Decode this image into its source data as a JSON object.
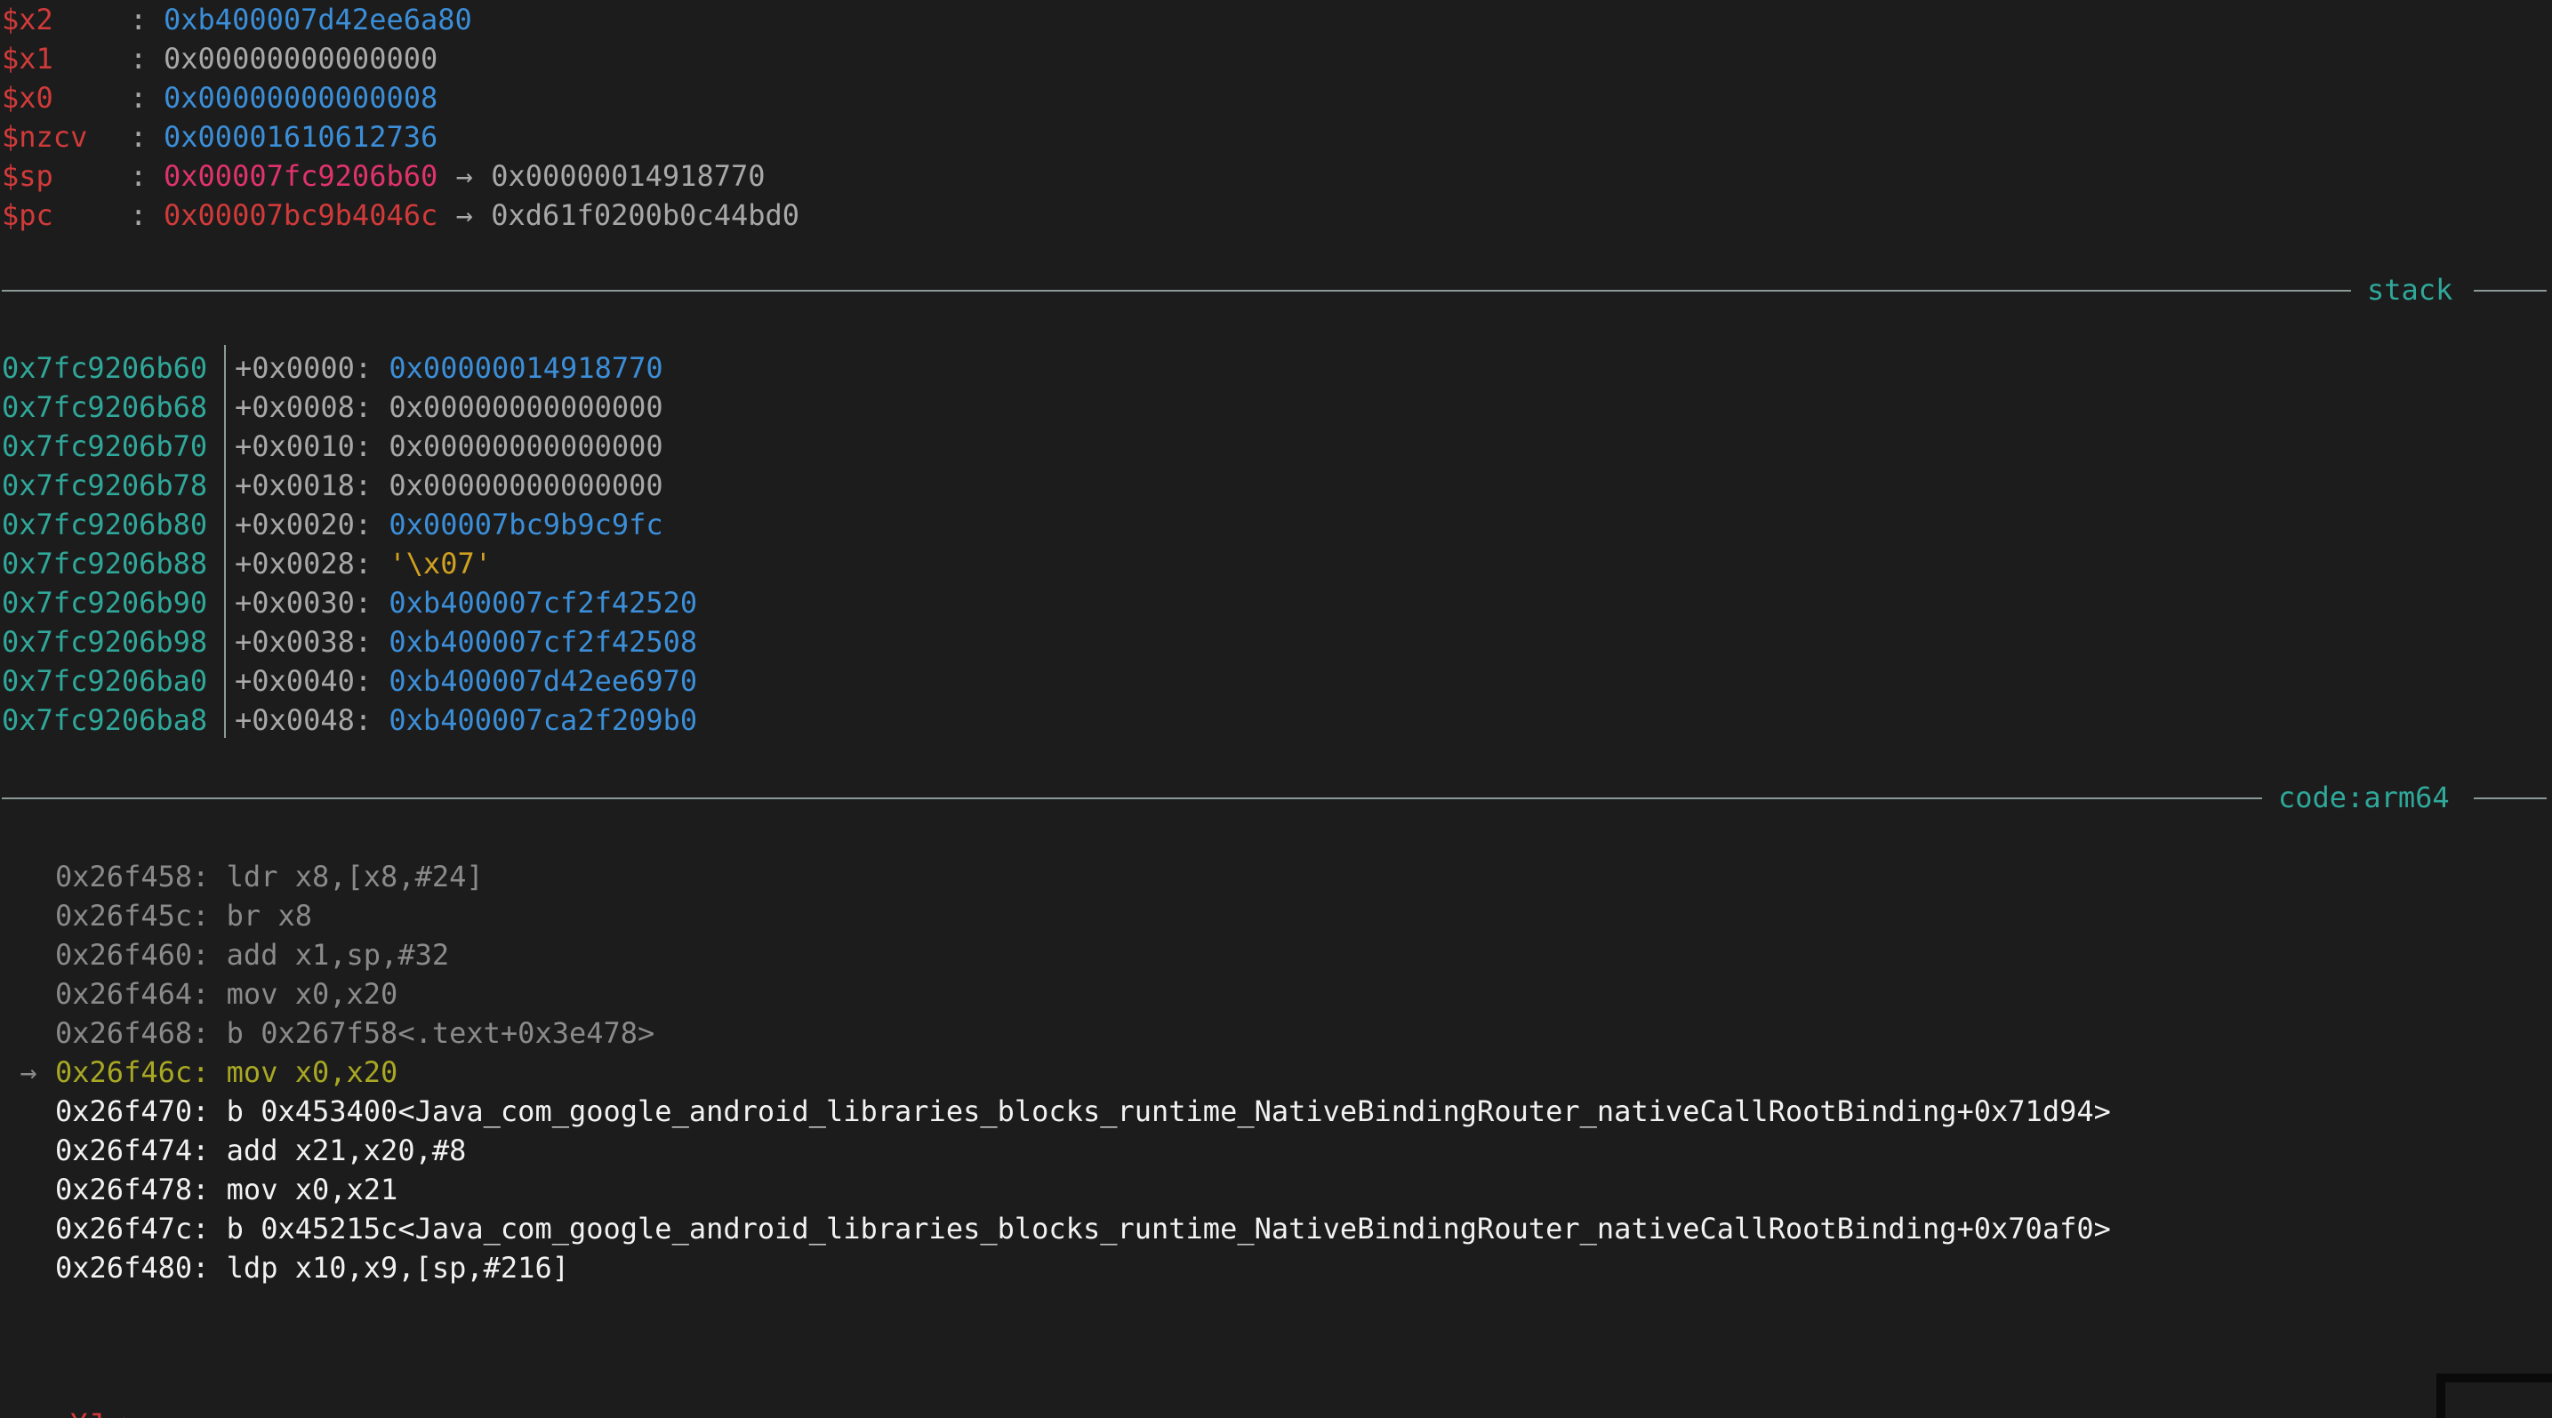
{
  "registers": [
    {
      "name": "$x2",
      "value": "0xb400007d42ee6a80",
      "color": "blue",
      "deref": null
    },
    {
      "name": "$x1",
      "value": "0x00000000000000",
      "color": "gray",
      "deref": null
    },
    {
      "name": "$x0",
      "value": "0x00000000000008",
      "color": "blue",
      "deref": null
    },
    {
      "name": "$nzcv",
      "value": "0x00001610612736",
      "color": "blue",
      "deref": null
    },
    {
      "name": "$sp",
      "value": "0x00007fc9206b60",
      "color": "pink",
      "deref": "0x00000014918770"
    },
    {
      "name": "$pc",
      "value": "0x00007bc9b4046c",
      "color": "red",
      "deref": "0xd61f0200b0c44bd0"
    }
  ],
  "separator_colon": ":",
  "arrow_glyph": "→",
  "stack_section": {
    "label": "stack",
    "rows": [
      {
        "addr": "0x7fc9206b60",
        "offset": "+0x0000:",
        "value": "0x00000014918770",
        "color": "blue"
      },
      {
        "addr": "0x7fc9206b68",
        "offset": "+0x0008:",
        "value": "0x00000000000000",
        "color": "gray"
      },
      {
        "addr": "0x7fc9206b70",
        "offset": "+0x0010:",
        "value": "0x00000000000000",
        "color": "gray"
      },
      {
        "addr": "0x7fc9206b78",
        "offset": "+0x0018:",
        "value": "0x00000000000000",
        "color": "gray"
      },
      {
        "addr": "0x7fc9206b80",
        "offset": "+0x0020:",
        "value": "0x00007bc9b9c9fc",
        "color": "blue"
      },
      {
        "addr": "0x7fc9206b88",
        "offset": "+0x0028:",
        "value": "'\\x07'",
        "color": "yellow"
      },
      {
        "addr": "0x7fc9206b90",
        "offset": "+0x0030:",
        "value": "0xb400007cf2f42520",
        "color": "blue"
      },
      {
        "addr": "0x7fc9206b98",
        "offset": "+0x0038:",
        "value": "0xb400007cf2f42508",
        "color": "blue"
      },
      {
        "addr": "0x7fc9206ba0",
        "offset": "+0x0040:",
        "value": "0xb400007d42ee6970",
        "color": "blue"
      },
      {
        "addr": "0x7fc9206ba8",
        "offset": "+0x0048:",
        "value": "0xb400007ca2f209b0",
        "color": "blue"
      }
    ]
  },
  "code_section": {
    "label": "code:arm64",
    "current_marker": "→",
    "lines": [
      {
        "addr": "0x26f458:",
        "instr": "ldr x8,[x8,#24]",
        "state": "past"
      },
      {
        "addr": "0x26f45c:",
        "instr": "br x8",
        "state": "past"
      },
      {
        "addr": "0x26f460:",
        "instr": "add x1,sp,#32",
        "state": "past"
      },
      {
        "addr": "0x26f464:",
        "instr": "mov x0,x20",
        "state": "past"
      },
      {
        "addr": "0x26f468:",
        "instr": "b 0x267f58<.text+0x3e478>",
        "state": "past"
      },
      {
        "addr": "0x26f46c:",
        "instr": "mov x0,x20",
        "state": "current"
      },
      {
        "addr": "0x26f470:",
        "instr": "b 0x453400<Java_com_google_android_libraries_blocks_runtime_NativeBindingRouter_nativeCallRootBinding+0x71d94>",
        "state": "next"
      },
      {
        "addr": "0x26f474:",
        "instr": "add x21,x20,#8",
        "state": "next"
      },
      {
        "addr": "0x26f478:",
        "instr": "mov x0,x21",
        "state": "next"
      },
      {
        "addr": "0x26f47c:",
        "instr": "b 0x45215c<Java_com_google_android_libraries_blocks_runtime_NativeBindingRouter_nativeCallRootBinding+0x70af0>",
        "state": "next"
      },
      {
        "addr": "0x26f480:",
        "instr": "ldp x10,x9,[sp,#216]",
        "state": "next"
      }
    ]
  },
  "prompt": {
    "text": "YJ ➤",
    "input_value": ""
  }
}
